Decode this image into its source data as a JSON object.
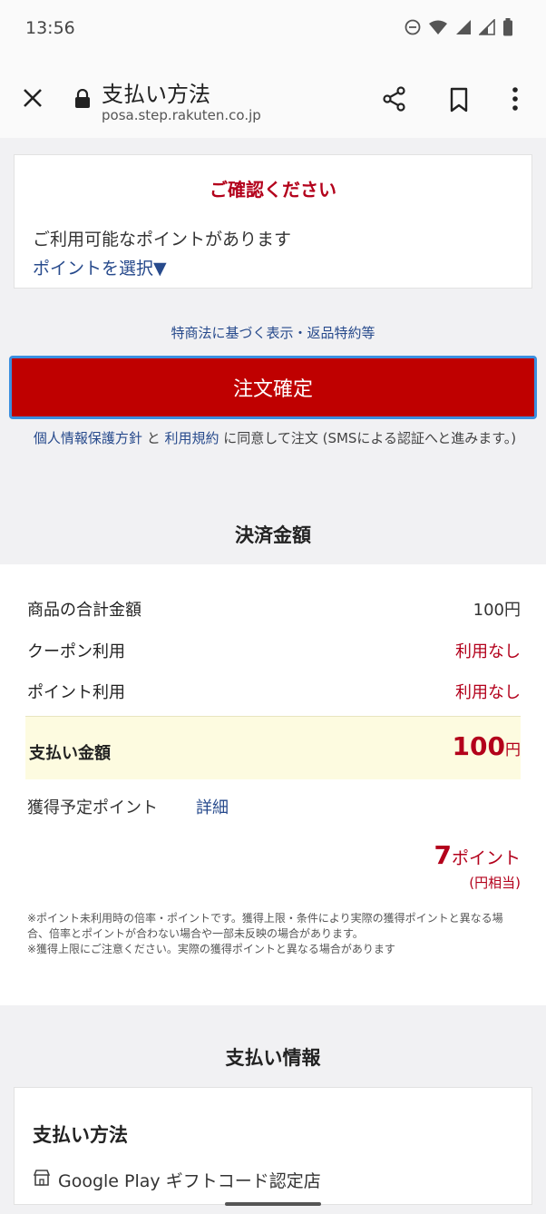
{
  "status_bar": {
    "time": "13:56",
    "icons": [
      "do-not-disturb-icon",
      "wifi-icon",
      "signal-icon",
      "signal-icon",
      "battery-icon"
    ]
  },
  "toolbar": {
    "title": "支払い方法",
    "url": "posa.step.rakuten.co.jp",
    "icons": [
      "close-icon",
      "lock-icon",
      "share-icon",
      "bookmark-icon",
      "more-vert-icon"
    ]
  },
  "notice": {
    "heading": "ご確認ください",
    "message": "ご利用可能なポイントがあります",
    "select_link": "ポイントを選択▼"
  },
  "legal_link": "特商法に基づく表示・返品特約等",
  "order_button": "注文確定",
  "consent": {
    "privacy_link": "個人情報保護方針",
    "and": " と ",
    "terms_link": "利用規約",
    "rest": " に同意して注文 (SMSによる認証へと進みます。)"
  },
  "payment_amount": {
    "section_title": "決済金額",
    "rows": [
      {
        "label": "商品の合計金額",
        "value": "100円"
      },
      {
        "label": "クーポン利用",
        "value": "利用なし"
      },
      {
        "label": "ポイント利用",
        "value": "利用なし"
      }
    ],
    "total_label": "支払い金額",
    "total_value": "100",
    "total_unit": "円",
    "points_label": "獲得予定ポイント",
    "points_detail_link": "詳細",
    "points_value": "7",
    "points_unit": "ポイント",
    "points_sub": "(円相当)",
    "note1": "※ポイント未利用時の倍率・ポイントです。獲得上限・条件により実際の獲得ポイントと異なる場合、倍率とポイントが合わない場合や一部未反映の場合があります。",
    "note2": "※獲得上限にご注意ください。実際の獲得ポイントと異なる場合があります"
  },
  "payment_info": {
    "section_title": "支払い情報",
    "method_label": "支払い方法",
    "store": "Google Play ギフトコード認定店",
    "store_icon": "store-icon"
  },
  "colors": {
    "accent_red": "#bf0000",
    "link_blue": "#274a8c",
    "focus_blue": "#3b8fe0"
  }
}
